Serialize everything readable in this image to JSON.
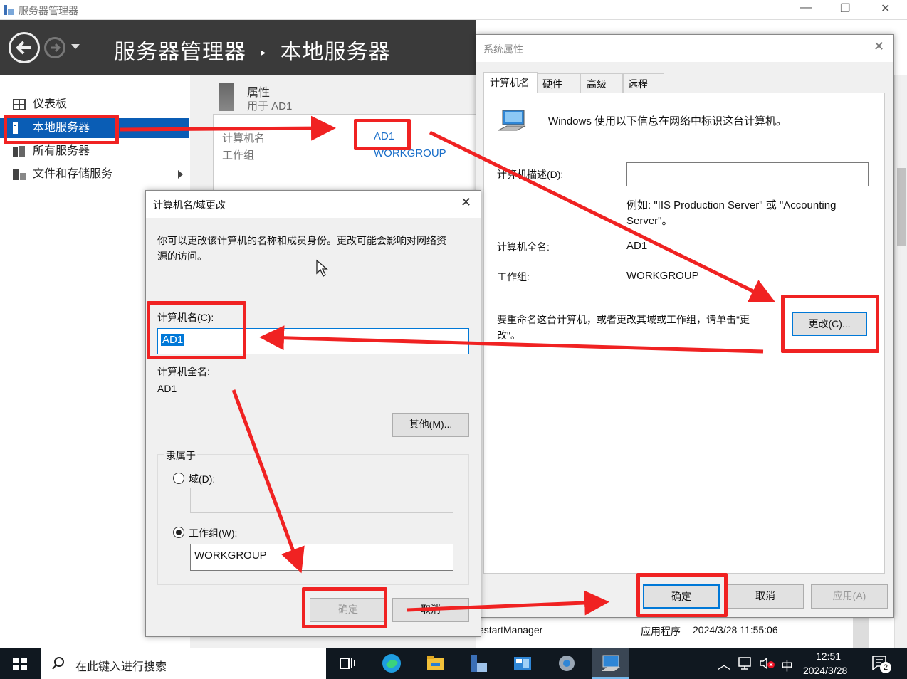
{
  "window": {
    "title": "服务器管理器",
    "minimize": "—",
    "restore": "❐",
    "close": "✕"
  },
  "header": {
    "breadcrumb_root": "服务器管理器",
    "breadcrumb_sep": "‣",
    "breadcrumb_page": "本地服务器"
  },
  "sidebar": {
    "items": [
      {
        "label": "仪表板"
      },
      {
        "label": "本地服务器"
      },
      {
        "label": "所有服务器"
      },
      {
        "label": "文件和存储服务"
      }
    ]
  },
  "properties": {
    "title": "属性",
    "subtitle": "用于 AD1",
    "computer_name_label": "计算机名",
    "computer_name_value": "AD1",
    "workgroup_label": "工作组",
    "workgroup_value": "WORKGROUP"
  },
  "sysprops": {
    "title": "系统属性",
    "tabs": [
      "计算机名",
      "硬件",
      "高级",
      "远程"
    ],
    "intro": "Windows 使用以下信息在网络中标识这台计算机。",
    "desc_label": "计算机描述(D):",
    "desc_value": "",
    "example_line1": "例如: \"IIS Production Server\" 或 \"Accounting",
    "example_line2": "Server\"。",
    "fullname_label": "计算机全名:",
    "fullname_value": "AD1",
    "workgroup_label": "工作组:",
    "workgroup_value": "WORKGROUP",
    "rename_text1": "要重命名这台计算机，或者更改其域或工作组，请单击\"更",
    "rename_text2": "改\"。",
    "change_button": "更改(C)...",
    "ok_button": "确定",
    "cancel_button": "取消",
    "apply_button": "应用(A)"
  },
  "rename": {
    "title": "计算机名/域更改",
    "intro1": "你可以更改该计算机的名称和成员身份。更改可能会影响对网络资",
    "intro2": "源的访问。",
    "name_label": "计算机名(C):",
    "name_value": "AD1",
    "fullname_label": "计算机全名:",
    "fullname_value": "AD1",
    "more_button": "其他(M)...",
    "member_group": "隶属于",
    "domain_label": "域(D):",
    "domain_value": "",
    "workgroup_label": "工作组(W):",
    "workgroup_value": "WORKGROUP",
    "ok_button": "确定",
    "cancel_button": "取消"
  },
  "events": {
    "source": "estartManager",
    "type": "应用程序",
    "time": "2024/3/28 11:55:06"
  },
  "taskbar": {
    "search_placeholder": "在此键入进行搜索",
    "ime": "中",
    "clock_time": "12:51",
    "clock_date": "2024/3/28",
    "notification_count": "2"
  },
  "colors": {
    "accent": "#0a5db5",
    "annotation": "#f02222",
    "header_bg": "#3a3a3a",
    "taskbar_bg": "#101820"
  }
}
